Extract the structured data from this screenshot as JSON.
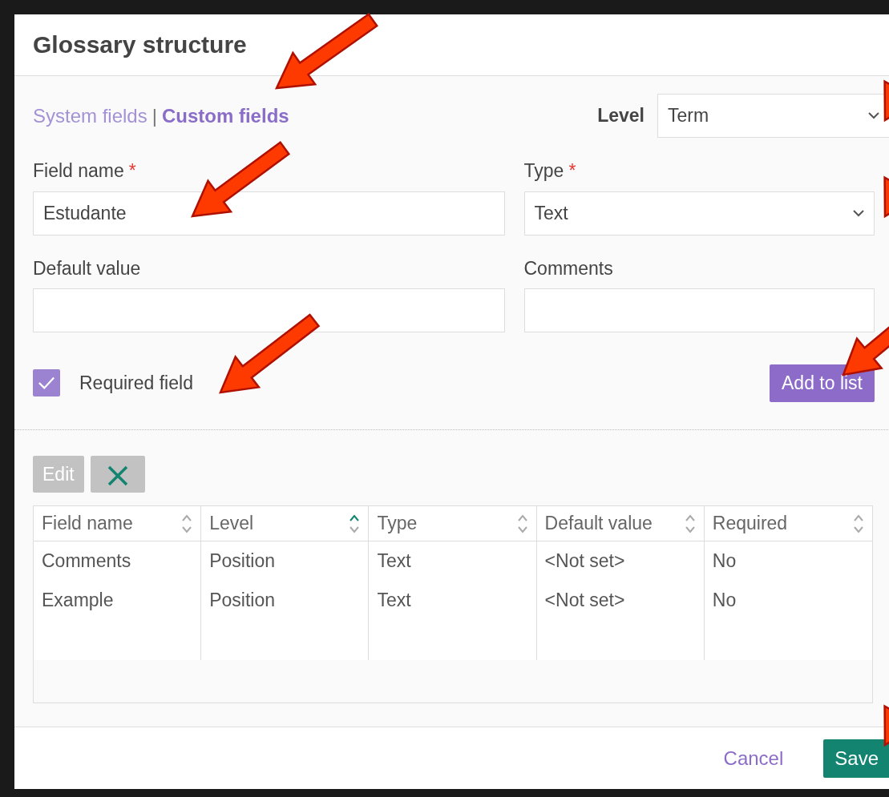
{
  "dialog": {
    "title": "Glossary structure"
  },
  "field_tabs": [
    {
      "label": "System fields",
      "selected": false
    },
    {
      "label": "Custom fields",
      "selected": true
    }
  ],
  "field_tabs_separator": "|",
  "level": {
    "label": "Level",
    "value": "Term"
  },
  "form": {
    "field_name": {
      "label": "Field name",
      "required_mark": "*",
      "value": "Estudante"
    },
    "type": {
      "label": "Type",
      "required_mark": "*",
      "value": "Text"
    },
    "default_value": {
      "label": "Default value"
    },
    "comments": {
      "label": "Comments"
    },
    "required_field": {
      "label": "Required field",
      "checked": true
    },
    "add_button": "Add to list"
  },
  "toolbar": {
    "edit": {
      "label": "Edit",
      "disabled": true
    },
    "delete": {
      "disabled": false
    }
  },
  "table": {
    "columns": [
      {
        "label": "Field name",
        "sorted": false
      },
      {
        "label": "Level",
        "sorted": true
      },
      {
        "label": "Type",
        "sorted": false
      },
      {
        "label": "Default value",
        "sorted": false
      },
      {
        "label": "Required",
        "sorted": false
      }
    ],
    "rows": [
      [
        "Comments",
        "Position",
        "Text",
        "<Not set>",
        "No"
      ],
      [
        "Example",
        "Position",
        "Text",
        "<Not set>",
        "No"
      ]
    ]
  },
  "footer": {
    "cancel": "Cancel",
    "save": "Save"
  },
  "annotations": [
    {
      "kind": "arrow"
    },
    {
      "kind": "arrow"
    },
    {
      "kind": "arrow"
    },
    {
      "kind": "arrow"
    },
    {
      "kind": "arrow"
    },
    {
      "kind": "arrow"
    },
    {
      "kind": "arrow"
    }
  ]
}
